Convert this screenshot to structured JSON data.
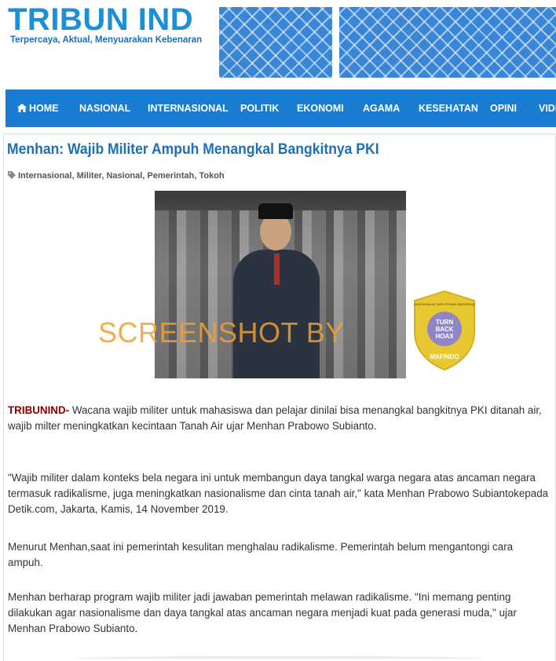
{
  "site": {
    "title": "TRIBUN IND",
    "tagline": "Terpercaya, Aktual, Menyuarakan Kebenaran"
  },
  "nav": {
    "items": [
      "HOME",
      "NASIONAL",
      "INTERNASIONAL",
      "POLITIK",
      "EKONOMI",
      "AGAMA",
      "KESEHATAN",
      "OPINI",
      "VIDEO"
    ]
  },
  "article": {
    "title": "Menhan: Wajib Militer Ampuh Menangkal Bangkitnya PKI",
    "tags": "Internasional, Militer, Nasional, Pemerintah, Tokoh",
    "image": {
      "watermark": "SCREENSHOT BY",
      "badge_top": "MASYARAKAT ANTI FITNAH INDONESIA",
      "badge_center": [
        "TURN",
        "BACK",
        "HOAX"
      ],
      "badge_bottom": "MAFINDO"
    },
    "lead_tag": "TRIBUNIND-",
    "p1": " Wacana wajib militer untuk mahasiswa dan pelajar dinilai bisa menangkal bangkitnya PKI ditanah air, wajib milter meningkatkan kecintaan Tanah Air ujar Menhan Prabowo Subianto.",
    "p2": "\"Wajib militer dalam konteks bela negara ini untuk membangun daya tangkal warga negara atas ancaman negara termasuk radikalisme, juga meningkatkan nasionalisme dan cinta tanah air,\" kata Menhan Prabowo Subiantokepada Detik.com, Jakarta, Kamis, 14 November 2019.",
    "p3": "Menurut Menhan,saat ini pemerintah kesulitan menghalau radikalisme. Pemerintah belum mengantongi cara ampuh.",
    "p4": "Menhan berharap program wajib militer jadi jawaban pemerintah melawan radikalisme. \"Ini memang penting dilakukan agar nasionalisme dan daya tangkal atas ancaman negara menjadi kuat pada generasi muda,\" ujar Menhan Prabowo Subianto."
  },
  "colors": {
    "brand": "#1d8fd6",
    "nav_bg": "#1a7cd1",
    "title": "#1d6fb8",
    "lead_tag": "#8b0000",
    "watermark": "#f0a030",
    "badge": "#e8c832"
  }
}
